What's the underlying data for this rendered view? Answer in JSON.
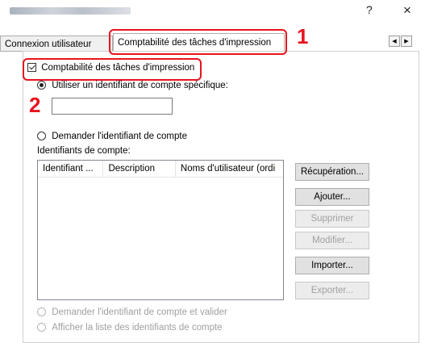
{
  "window": {
    "help_label": "?",
    "close_label": "×"
  },
  "tabs": [
    {
      "label": "Connexion utilisateur"
    },
    {
      "label": "Comptabilité des tâches d'impression"
    }
  ],
  "tab_scroll": {
    "left": "◀",
    "right": "▶"
  },
  "form": {
    "enable_checkbox_label": "Comptabilité des tâches d'impression",
    "radio_specific_label": "Utiliser un identifiant de compte spécifique:",
    "account_id_value": "",
    "radio_prompt_label": "Demander l'identifiant de compte",
    "account_ids_heading": "Identifiants de compte:",
    "columns": [
      "Identifiant ...",
      "Description",
      "Noms d'utilisateur (ordi"
    ],
    "radio_prompt_validate_label": "Demander l'identifiant de compte et valider",
    "radio_show_list_label": "Afficher la liste des identifiants de compte"
  },
  "buttons": {
    "retrieve": "Récupération...",
    "add": "Ajouter...",
    "delete": "Supprimer",
    "edit": "Modifier...",
    "import": "Importer...",
    "export": "Exporter..."
  },
  "annotations": {
    "step1": "1",
    "step2": "2",
    "color": "#e8141e"
  }
}
